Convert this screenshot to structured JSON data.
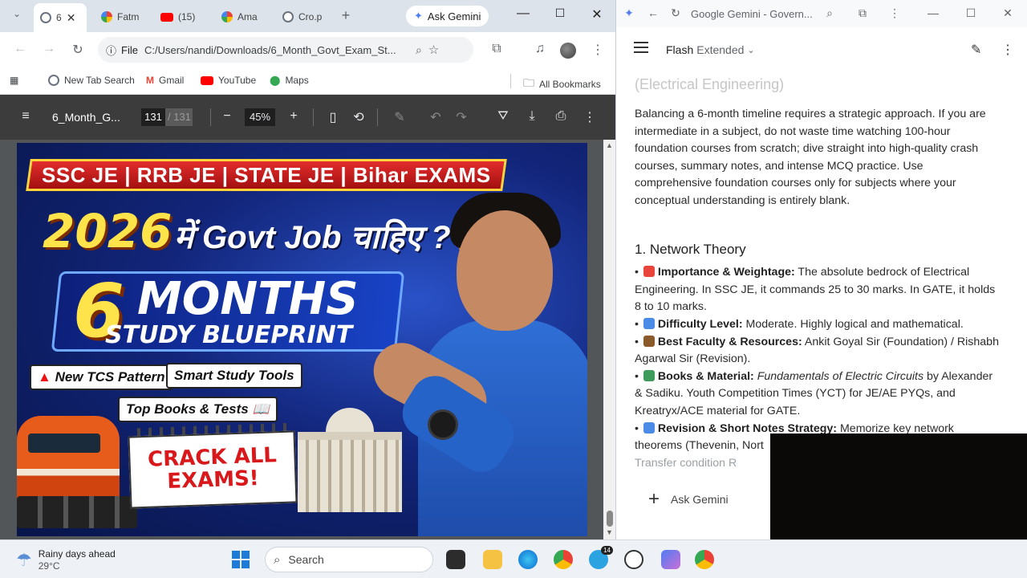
{
  "left_browser": {
    "tabs": [
      {
        "label": "6",
        "active": true
      },
      {
        "label": "Fatm"
      },
      {
        "label": "(15)"
      },
      {
        "label": "Ama"
      },
      {
        "label": "Cro.p"
      }
    ],
    "ask_gemini_label": "Ask Gemini",
    "omnibox": {
      "scheme_label": "File",
      "url": "C:/Users/nandi/Downloads/6_Month_Govt_Exam_St..."
    },
    "bookmarks": [
      "New Tab Search",
      "Gmail",
      "YouTube",
      "Maps"
    ],
    "all_bookmarks_label": "All Bookmarks",
    "pdf": {
      "title": "6_Month_G...",
      "current_page": "131",
      "total_pages": "/ 131",
      "zoom": "45%"
    },
    "thumbnail": {
      "top_banner": "SSC JE | RRB JE | STATE JE | Bihar EXAMS",
      "headline_year": "2026",
      "headline_rest": "में Govt Job चाहिए ?🔥",
      "big_number": "6",
      "months_word": "MONTHS",
      "subtitle": "STUDY BLUEPRINT",
      "pill_tcs": "New TCS Pattern",
      "pill_smart": "Smart Study Tools",
      "pill_books": "Top Books & Tests",
      "calendar_text": "CRACK ALL EXAMS!"
    }
  },
  "right_browser": {
    "tab_title": "Google Gemini - Govern...",
    "model_name": "Flash",
    "model_mode": "Extended",
    "faded_heading": "(Electrical Engineering)",
    "intro": "Balancing a 6-month timeline requires a strategic approach. If you are intermediate in a subject, do not waste time watching 100-hour foundation courses from scratch; dive straight into high-quality crash courses, summary notes, and intense MCQ practice. Use comprehensive foundation courses only for subjects where your conceptual understanding is entirely blank.",
    "section_title": "1. Network Theory",
    "bullets": [
      {
        "label": "Importance & Weightage:",
        "text": "The absolute bedrock of Electrical Engineering. In SSC JE, it commands 25 to 30 marks. In GATE, it holds 8 to 10 marks.",
        "emoji_color": "#e9453a"
      },
      {
        "label": "Difficulty Level:",
        "text": "Moderate. Highly logical and mathematical.",
        "emoji_color": "#4b8be8"
      },
      {
        "label": "Best Faculty & Resources:",
        "text": "Ankit Goyal Sir (Foundation) / Rishabh Agarwal Sir (Revision).",
        "emoji_color": "#8a5a2b"
      },
      {
        "label": "Books & Material:",
        "italic": "Fundamentals of Electric Circuits",
        "text": "by Alexander & Sadiku. Youth Competition Times (YCT) for JE/AE PYQs, and Kreatryx/ACE material for GATE.",
        "emoji_color": "#3d9c5b"
      },
      {
        "label": "Revision & Short Notes Strategy:",
        "text": "Memorize key network theorems (Thevenin, Nort",
        "emoji_color": "#4b8be8"
      }
    ],
    "cut_line": "Transfer condition R",
    "ask_placeholder": "Ask Gemini"
  },
  "taskbar": {
    "weather_title": "Rainy days ahead",
    "weather_temp": "29°C",
    "search_label": "Search",
    "badge_telegram": "14"
  }
}
